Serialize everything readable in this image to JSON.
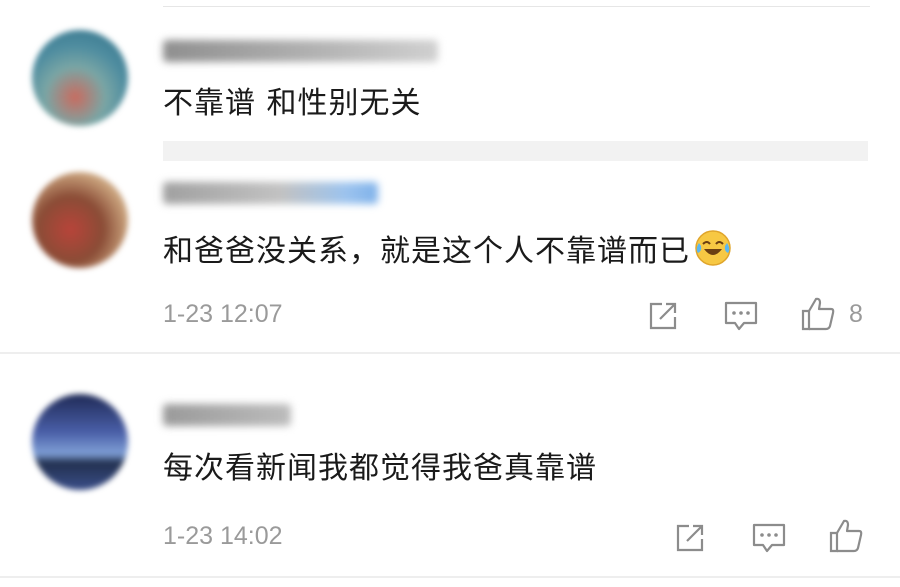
{
  "comments": [
    {
      "text": "不靠谱 和性别无关"
    },
    {
      "text": "和爸爸没关系，就是这个人不靠谱而已",
      "emoji": "laughing-crying-emoji",
      "time": "1-23 12:07",
      "like_count": "8"
    },
    {
      "text": "每次看新闻我都觉得我爸真靠谱",
      "time": "1-23 14:02",
      "like_count": ""
    }
  ],
  "icons": {
    "share": "share-icon",
    "reply": "comment-icon",
    "like": "thumbs-up-icon"
  },
  "colors": {
    "meta_text": "#9a9a9a",
    "icon_stroke": "#8c8c8c",
    "divider": "#eeeeee"
  }
}
